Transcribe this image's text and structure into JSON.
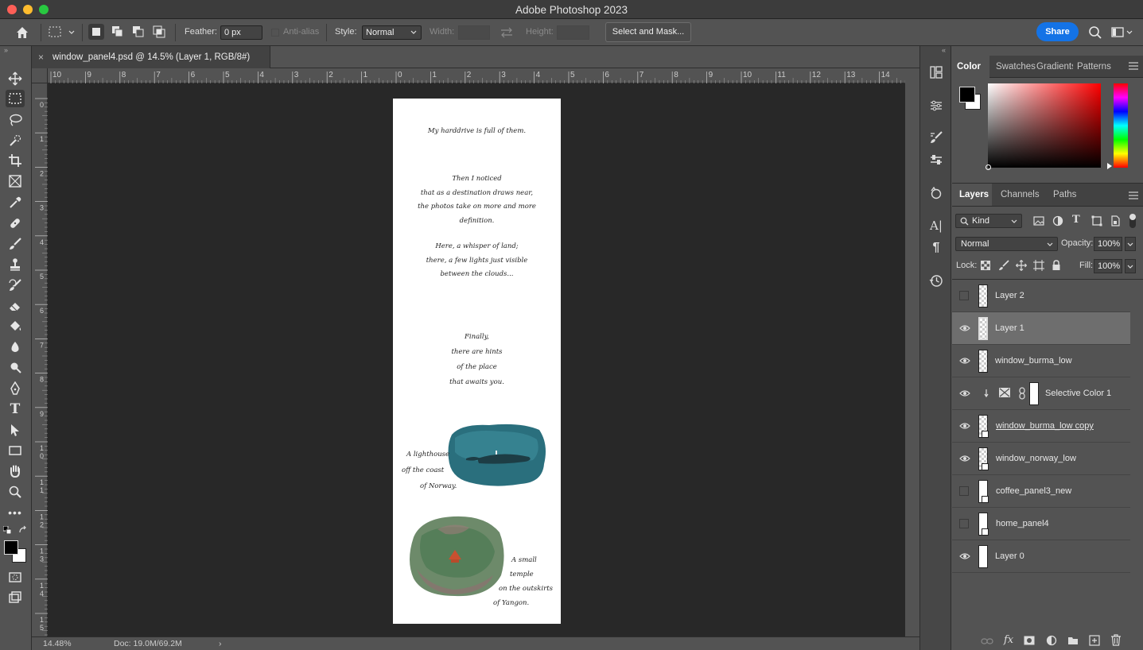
{
  "window": {
    "title": "Adobe Photoshop 2023"
  },
  "options_bar": {
    "feather_label": "Feather:",
    "feather_value": "0 px",
    "antialias_label": "Anti-alias",
    "style_label": "Style:",
    "style_value": "Normal",
    "width_label": "Width:",
    "height_label": "Height:",
    "select_mask_label": "Select and Mask...",
    "share_label": "Share"
  },
  "document": {
    "tab_title": "window_panel4.psd @ 14.5% (Layer 1, RGB/8#)",
    "zoom": "14.48%",
    "doc_size": "Doc: 19.0M/69.2M"
  },
  "ruler_top": [
    "10",
    "9",
    "8",
    "7",
    "6",
    "5",
    "4",
    "3",
    "2",
    "1",
    "0",
    "1",
    "2",
    "3",
    "4",
    "5",
    "6",
    "7",
    "8",
    "9",
    "10",
    "11",
    "12",
    "13",
    "14"
  ],
  "ruler_left": [
    "0",
    "1",
    "2",
    "3",
    "4",
    "5",
    "6",
    "7",
    "8",
    "9",
    "1 0",
    "1 1",
    "1 2",
    "1 3",
    "1 4",
    "1 5"
  ],
  "canvas_text": {
    "line1": "My harddrive is full of them.",
    "para2": [
      "Then I noticed",
      "that as a destination draws near,",
      "the photos take on more and more",
      "definition."
    ],
    "para3": [
      "Here, a whisper of land;",
      "there, a few lights just visible",
      "between the clouds..."
    ],
    "para4": [
      "Finally,",
      "there are hints",
      "of the place",
      "that awaits you."
    ],
    "caption1": [
      "A lighthouse",
      "off the coast",
      "of Norway."
    ],
    "caption2": [
      "A small",
      "temple",
      "on the outskirts",
      "of Yangon."
    ]
  },
  "color_panel": {
    "tabs": [
      "Color",
      "Swatches",
      "Gradients",
      "Patterns"
    ],
    "active": "Color"
  },
  "layers_panel": {
    "tabs": [
      "Layers",
      "Channels",
      "Paths"
    ],
    "active": "Layers",
    "filter_kind": "Kind",
    "blend_mode": "Normal",
    "opacity_label": "Opacity:",
    "opacity_value": "100%",
    "lock_label": "Lock:",
    "fill_label": "Fill:",
    "fill_value": "100%",
    "layers": [
      {
        "name": "Layer 2",
        "visible": false,
        "selected": false,
        "smart": false
      },
      {
        "name": "Layer 1",
        "visible": true,
        "selected": true,
        "smart": false
      },
      {
        "name": "window_burma_low",
        "visible": true,
        "selected": false,
        "smart": false
      },
      {
        "name": "Selective Color 1",
        "visible": true,
        "selected": false,
        "adjustment": true
      },
      {
        "name": "window_burma_low copy",
        "visible": true,
        "selected": false,
        "smart": true
      },
      {
        "name": "window_norway_low",
        "visible": true,
        "selected": false,
        "smart": true
      },
      {
        "name": "coffee_panel3_new",
        "visible": false,
        "selected": false,
        "smart": true
      },
      {
        "name": "home_panel4",
        "visible": false,
        "selected": false,
        "smart": true
      },
      {
        "name": "Layer 0",
        "visible": true,
        "selected": false,
        "smart": false
      }
    ]
  },
  "colors": {
    "share_button": "#1473e6",
    "foreground": "#000000",
    "background": "#ffffff"
  }
}
